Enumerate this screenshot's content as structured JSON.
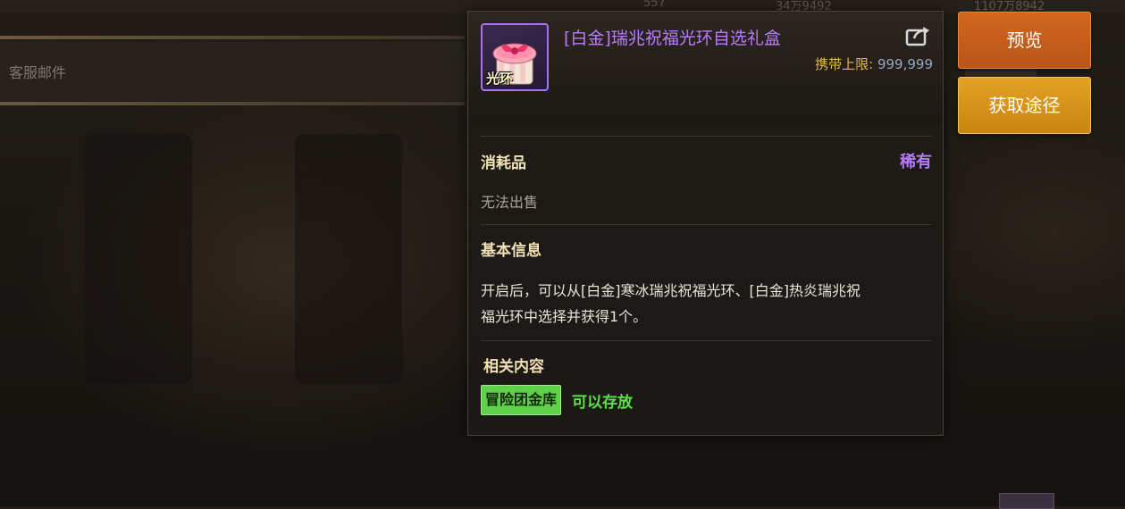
{
  "item": {
    "name": "[白金]瑞兆祝福光环自选礼盒",
    "icon_label": "光环",
    "carry_limit_label": "携带上限:",
    "carry_limit_value": "999,999",
    "category": "消耗品",
    "rarity": "稀有",
    "sell_status": "无法出售",
    "basic_info_title": "基本信息",
    "description_line1": "开启后，可以从[白金]寒冰瑞兆祝福光环、[白金]热炎瑞兆祝",
    "description_line2": "福光环中选择并获得1个。",
    "related_title": "相关内容",
    "storage_tag": "冒险团金库",
    "storage_note": "可以存放"
  },
  "buttons": {
    "preview": "预览",
    "source": "获取途径"
  },
  "background": {
    "tab_label": "客服邮件",
    "currency_1": "557",
    "currency_2": "34万9492",
    "currency_3": "1107万8942"
  },
  "colors": {
    "rarity_purple": "#b87bff",
    "gold_label": "#e8b84a",
    "green_tag": "#5fd04a",
    "preview_button": "#c95f1b",
    "source_button": "#d9961a"
  },
  "icons": [
    "share-icon",
    "gift-box-icon"
  ]
}
